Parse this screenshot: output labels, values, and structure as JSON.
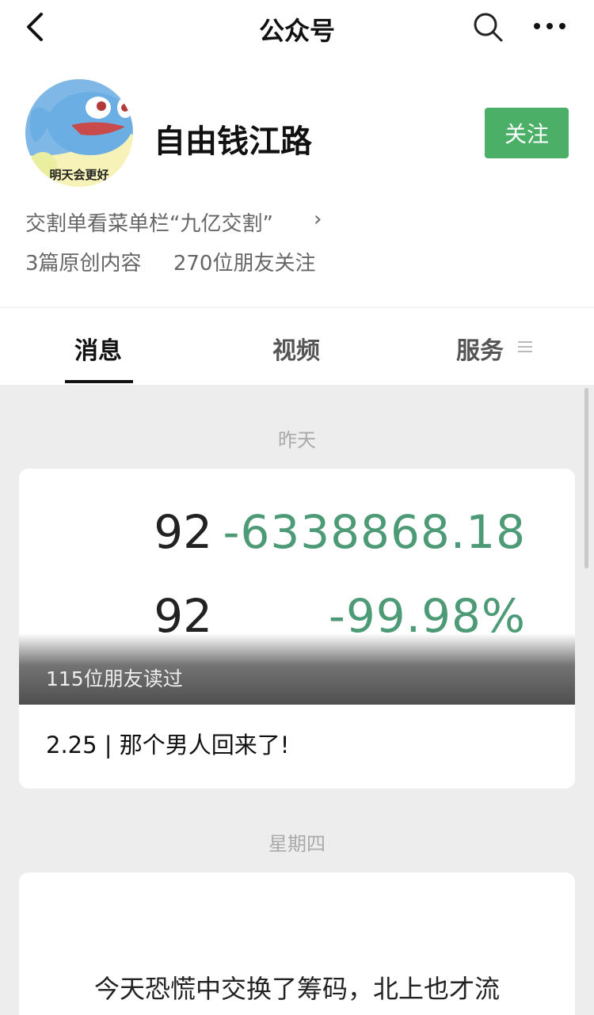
{
  "nav": {
    "title": "公众号",
    "icons": [
      "back-chevron-icon",
      "search-icon",
      "more-icon"
    ]
  },
  "account": {
    "avatar_caption": "明天会更好",
    "name": "自由钱江路",
    "follow_label": "关注",
    "follow_color": "#4caf68",
    "description": "交割单看菜单栏“九亿交割”",
    "description_chevron": "›",
    "original_count": "3篇原创内容",
    "follower_count": "270位朋友关注"
  },
  "tabs": [
    {
      "label": "消息",
      "active": true
    },
    {
      "label": "视频",
      "active": false
    },
    {
      "label": "服务",
      "active": false
    }
  ],
  "feed": [
    {
      "date": "昨天",
      "cover_rows": [
        {
          "left": "92",
          "right": "-6338868.18"
        },
        {
          "left": "92",
          "right": "-99.98%"
        }
      ],
      "read_count": "115位朋友读过",
      "title": "2.25 | 那个男人回来了!"
    },
    {
      "date": "星期四",
      "text": "今天恐慌中交换了筹码，北上也才流"
    }
  ],
  "colors": {
    "cover_numbers_accent": "#4d9a76",
    "background": "#ededed"
  }
}
